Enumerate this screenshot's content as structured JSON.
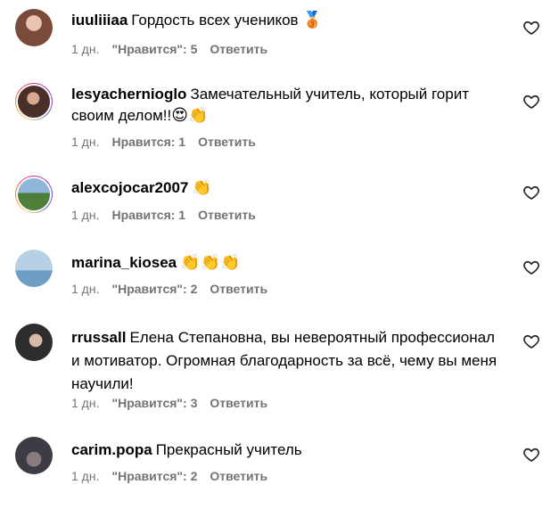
{
  "comments": [
    {
      "username": "iuuliiiaa",
      "text": "Гордость всех учеников",
      "emoji": "🥉",
      "time": "1 дн.",
      "likes": "\"Нравится\": 5",
      "reply": "Ответить",
      "story": false,
      "avatar_color": "#7a4a3a"
    },
    {
      "username": "lesyachernioglo",
      "text": "Замечательный учитель, который горит своим делом!!",
      "emoji": "😍👏",
      "time": "1 дн.",
      "likes": "Нравится: 1",
      "reply": "Ответить",
      "story": true,
      "avatar_color": "#5a3a30"
    },
    {
      "username": "alexcojocar2007",
      "text": "",
      "emoji": "👏",
      "time": "1 дн.",
      "likes": "Нравится: 1",
      "reply": "Ответить",
      "story": true,
      "avatar_color": "#3d6b3a"
    },
    {
      "username": "marina_kiosea",
      "text": "",
      "emoji": "👏👏👏",
      "time": "1 дн.",
      "likes": "\"Нравится\": 2",
      "reply": "Ответить",
      "story": false,
      "avatar_color": "#6b8fae"
    },
    {
      "username": "rrussall",
      "text": "Елена Степановна, вы невероятный профессионал и мотиватор. Огромная благодарность за всё, чему вы меня научили!",
      "emoji": "",
      "time": "1 дн.",
      "likes": "\"Нравится\": 3",
      "reply": "Ответить",
      "story": false,
      "avatar_color": "#3a3a3a"
    },
    {
      "username": "carim.popa",
      "text": "Прекрасный учитель",
      "emoji": "",
      "time": "1 дн.",
      "likes": "\"Нравится\": 2",
      "reply": "Ответить",
      "story": false,
      "avatar_color": "#4a4a52"
    }
  ],
  "icons": {
    "like": "heart-outline-icon"
  },
  "colors": {
    "meta": "#737373",
    "story_ring": "#d62976"
  }
}
